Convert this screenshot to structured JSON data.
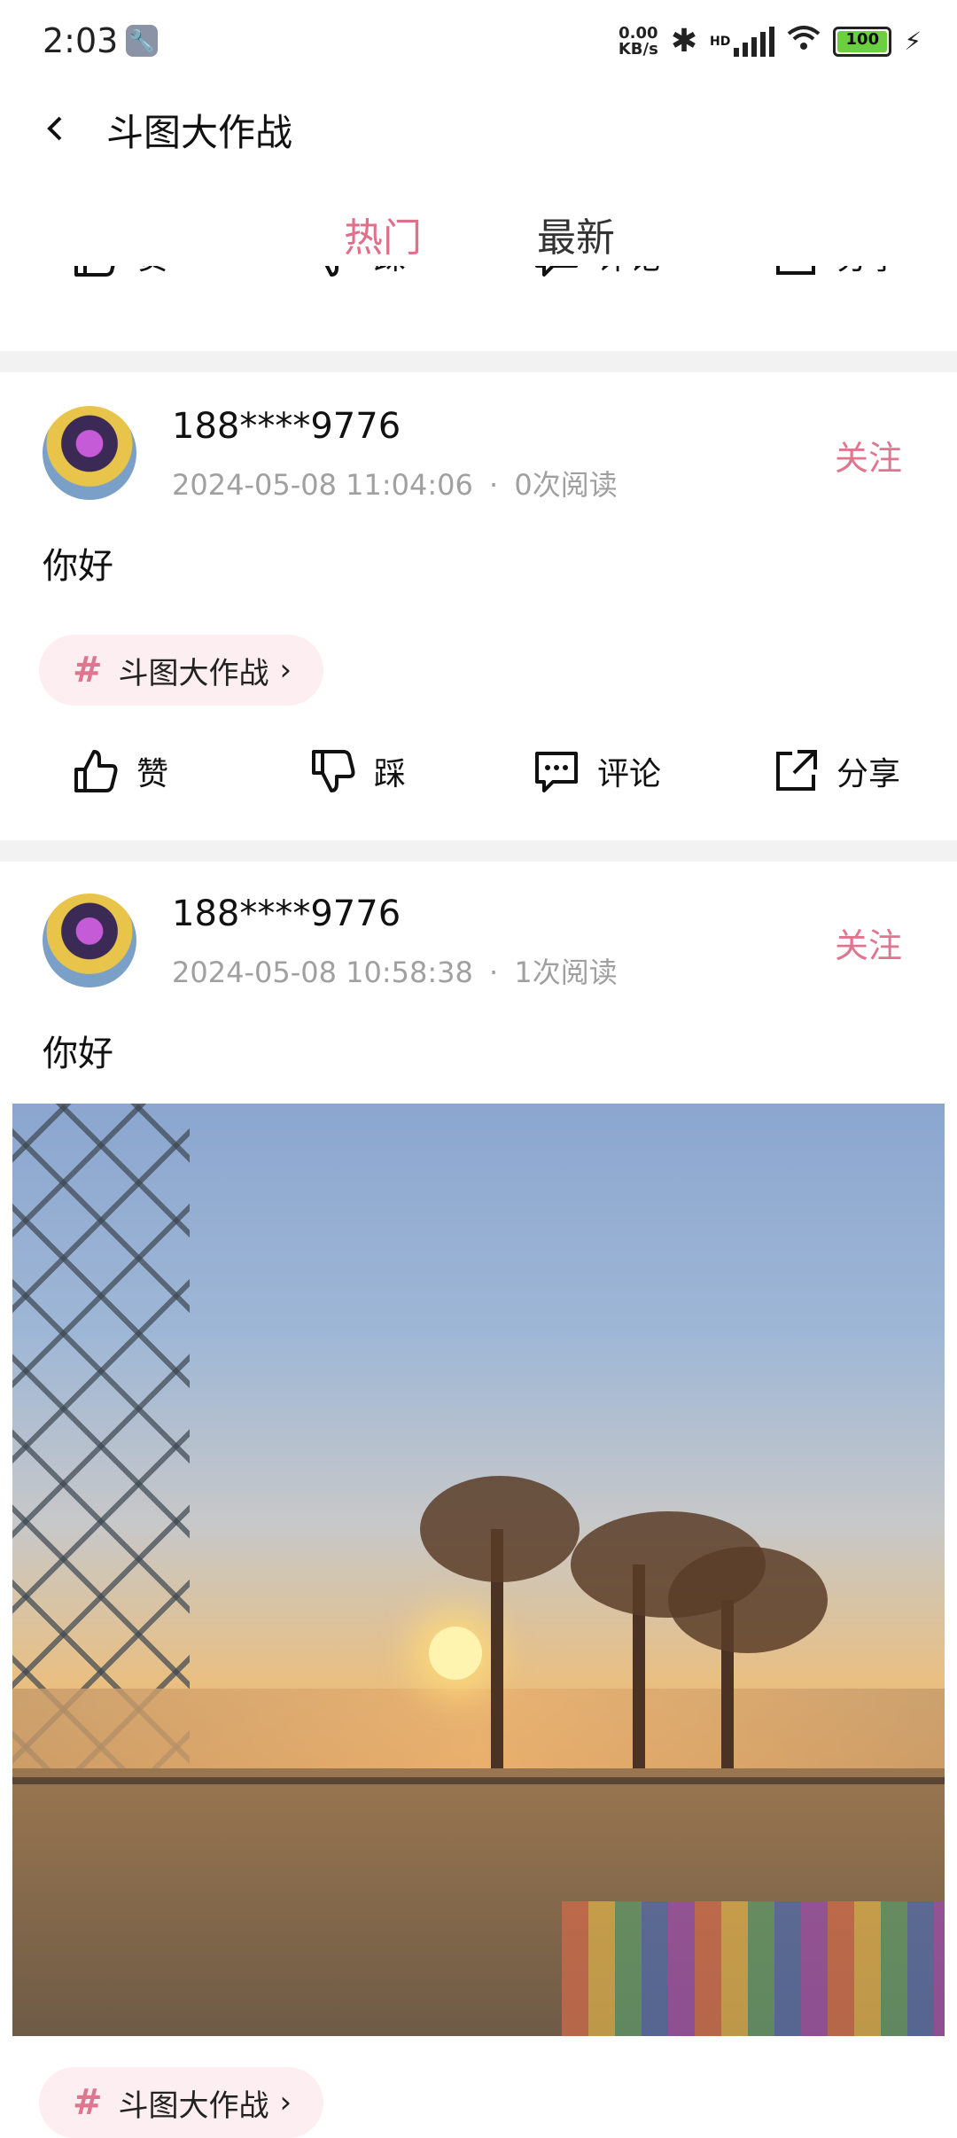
{
  "status_bar": {
    "time": "2:03",
    "net_speed_value": "0.00",
    "net_speed_unit": "KB/s",
    "network_label": "HD",
    "battery": "100"
  },
  "header": {
    "back_icon": "chevron-left-icon",
    "title": "斗图大作战"
  },
  "tabs": [
    {
      "label": "热门",
      "active": true,
      "color": "#e0708a"
    },
    {
      "label": "最新",
      "active": false
    }
  ],
  "actions": {
    "like": "赞",
    "dislike": "踩",
    "comment": "评论",
    "share": "分享"
  },
  "posts": [
    {
      "username": "188****9776",
      "timestamp": "2024-05-08 11:04:06",
      "reads": "0次阅读",
      "follow": "关注",
      "content": "你好",
      "tag": "斗图大作战"
    },
    {
      "username": "188****9776",
      "timestamp": "2024-05-08 10:58:38",
      "reads": "1次阅读",
      "follow": "关注",
      "content": "你好",
      "tag": "斗图大作战"
    }
  ],
  "meta_separator": "·",
  "tag_hash": "#",
  "accent_color": "#e07590"
}
